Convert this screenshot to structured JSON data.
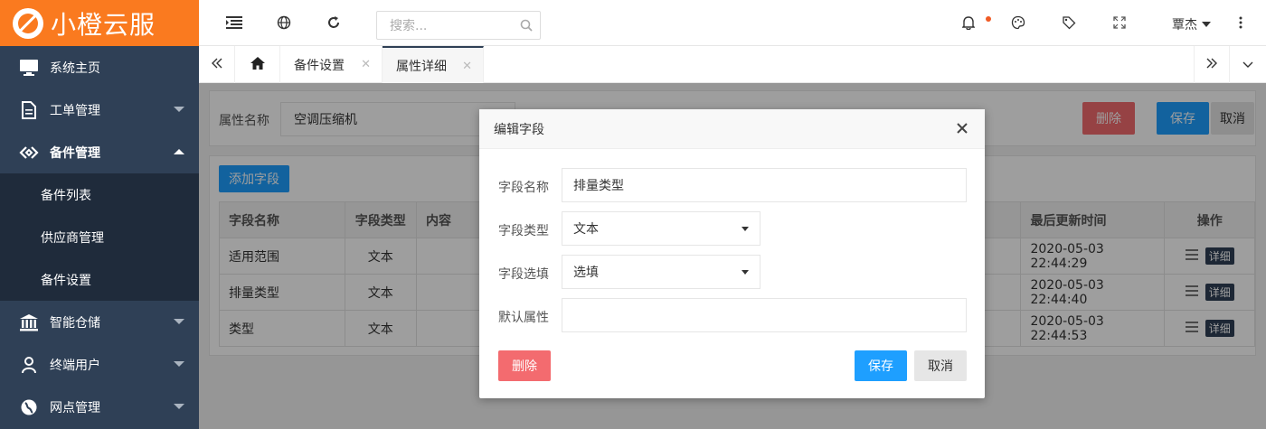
{
  "logo": {
    "text": "小橙云服"
  },
  "sidebar": {
    "items": [
      {
        "label": "系统主页",
        "icon": "monitor-icon"
      },
      {
        "label": "工单管理",
        "icon": "document-icon"
      },
      {
        "label": "备件管理",
        "icon": "diamond-link-icon"
      },
      {
        "label": "智能仓储",
        "icon": "bank-icon"
      },
      {
        "label": "终端用户",
        "icon": "user-icon"
      },
      {
        "label": "网点管理",
        "icon": "globe-icon"
      }
    ],
    "submenu": [
      {
        "label": "备件列表"
      },
      {
        "label": "供应商管理"
      },
      {
        "label": "备件设置"
      }
    ]
  },
  "topbar": {
    "search_placeholder": "搜索...",
    "user_name": "覃杰"
  },
  "tabs": [
    {
      "label": "备件设置"
    },
    {
      "label": "属性详细"
    }
  ],
  "panel": {
    "attr_label": "属性名称",
    "attr_value": "空调压缩机",
    "delete_label": "删除",
    "save_label": "保存",
    "cancel_label": "取消"
  },
  "list": {
    "add_label": "添加字段",
    "headers": [
      "字段名称",
      "字段类型",
      "内容",
      "最后更新时间",
      "操作"
    ],
    "rows": [
      {
        "name": "适用范围",
        "type": "文本",
        "updated": "2020-05-03 22:44:29"
      },
      {
        "name": "排量类型",
        "type": "文本",
        "updated": "2020-05-03 22:44:40"
      },
      {
        "name": "类型",
        "type": "文本",
        "updated": "2020-05-03 22:44:53"
      }
    ],
    "detail_label": "详细"
  },
  "modal": {
    "title": "编辑字段",
    "field_name_label": "字段名称",
    "field_name_value": "排量类型",
    "field_type_label": "字段类型",
    "field_type_value": "文本",
    "field_option_label": "字段选填",
    "field_option_value": "选填",
    "default_label": "默认属性",
    "default_value": "",
    "delete_label": "删除",
    "save_label": "保存",
    "cancel_label": "取消"
  },
  "colors": {
    "brand_orange": "#fa7a1f",
    "sidebar_bg": "#2f4056",
    "submenu_bg": "#1f2b3b",
    "primary_blue": "#1e9fff",
    "danger_red": "#f36b6f"
  }
}
